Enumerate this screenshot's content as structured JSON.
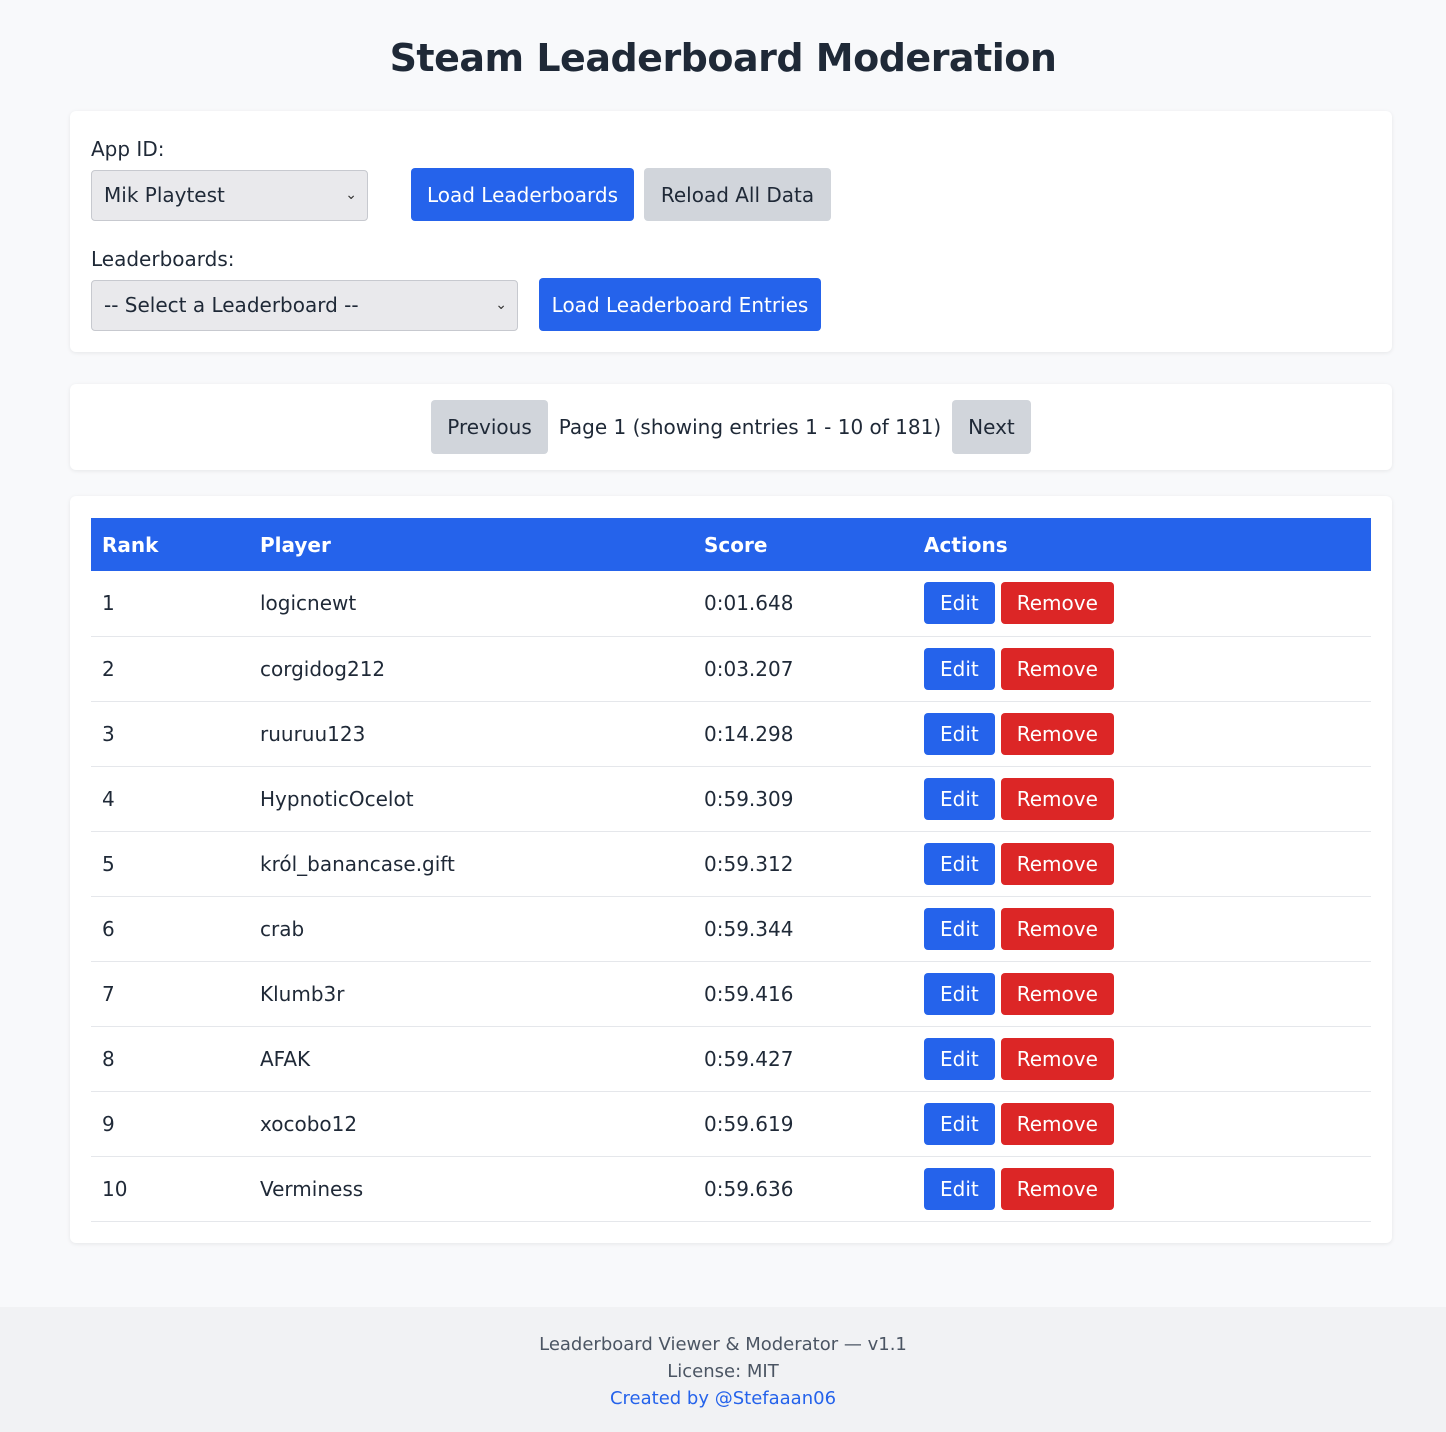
{
  "page": {
    "title": "Steam Leaderboard Moderation"
  },
  "controls": {
    "app_id_label": "App ID:",
    "app_id_selected": "Mik Playtest",
    "load_leaderboards": "Load Leaderboards",
    "reload_all": "Reload All Data",
    "leaderboards_label": "Leaderboards:",
    "leaderboard_selected": "-- Select a Leaderboard --",
    "load_entries": "Load Leaderboard Entries"
  },
  "pager": {
    "previous": "Previous",
    "info": "Page 1 (showing entries 1 - 10 of 181)",
    "next": "Next"
  },
  "table": {
    "headers": [
      "Rank",
      "Player",
      "Score",
      "Actions"
    ],
    "edit_label": "Edit",
    "remove_label": "Remove",
    "rows": [
      {
        "rank": "1",
        "player": "logicnewt",
        "score": "0:01.648"
      },
      {
        "rank": "2",
        "player": "corgidog212",
        "score": "0:03.207"
      },
      {
        "rank": "3",
        "player": "ruuruu123",
        "score": "0:14.298"
      },
      {
        "rank": "4",
        "player": "HypnoticOcelot",
        "score": "0:59.309"
      },
      {
        "rank": "5",
        "player": "król_banancase.gift",
        "score": "0:59.312"
      },
      {
        "rank": "6",
        "player": "crab",
        "score": "0:59.344"
      },
      {
        "rank": "7",
        "player": "Klumb3r",
        "score": "0:59.416"
      },
      {
        "rank": "8",
        "player": "AFAK",
        "score": "0:59.427"
      },
      {
        "rank": "9",
        "player": "xocobo12",
        "score": "0:59.619"
      },
      {
        "rank": "10",
        "player": "Verminess",
        "score": "0:59.636"
      }
    ]
  },
  "footer": {
    "line1": "Leaderboard Viewer & Moderator — v1.1",
    "line2": "License: MIT",
    "credit": "Created by @Stefaaan06"
  },
  "colors": {
    "primary": "#2563eb",
    "danger": "#dc2626",
    "secondary": "#d1d5db",
    "background": "#f8f9fb"
  }
}
